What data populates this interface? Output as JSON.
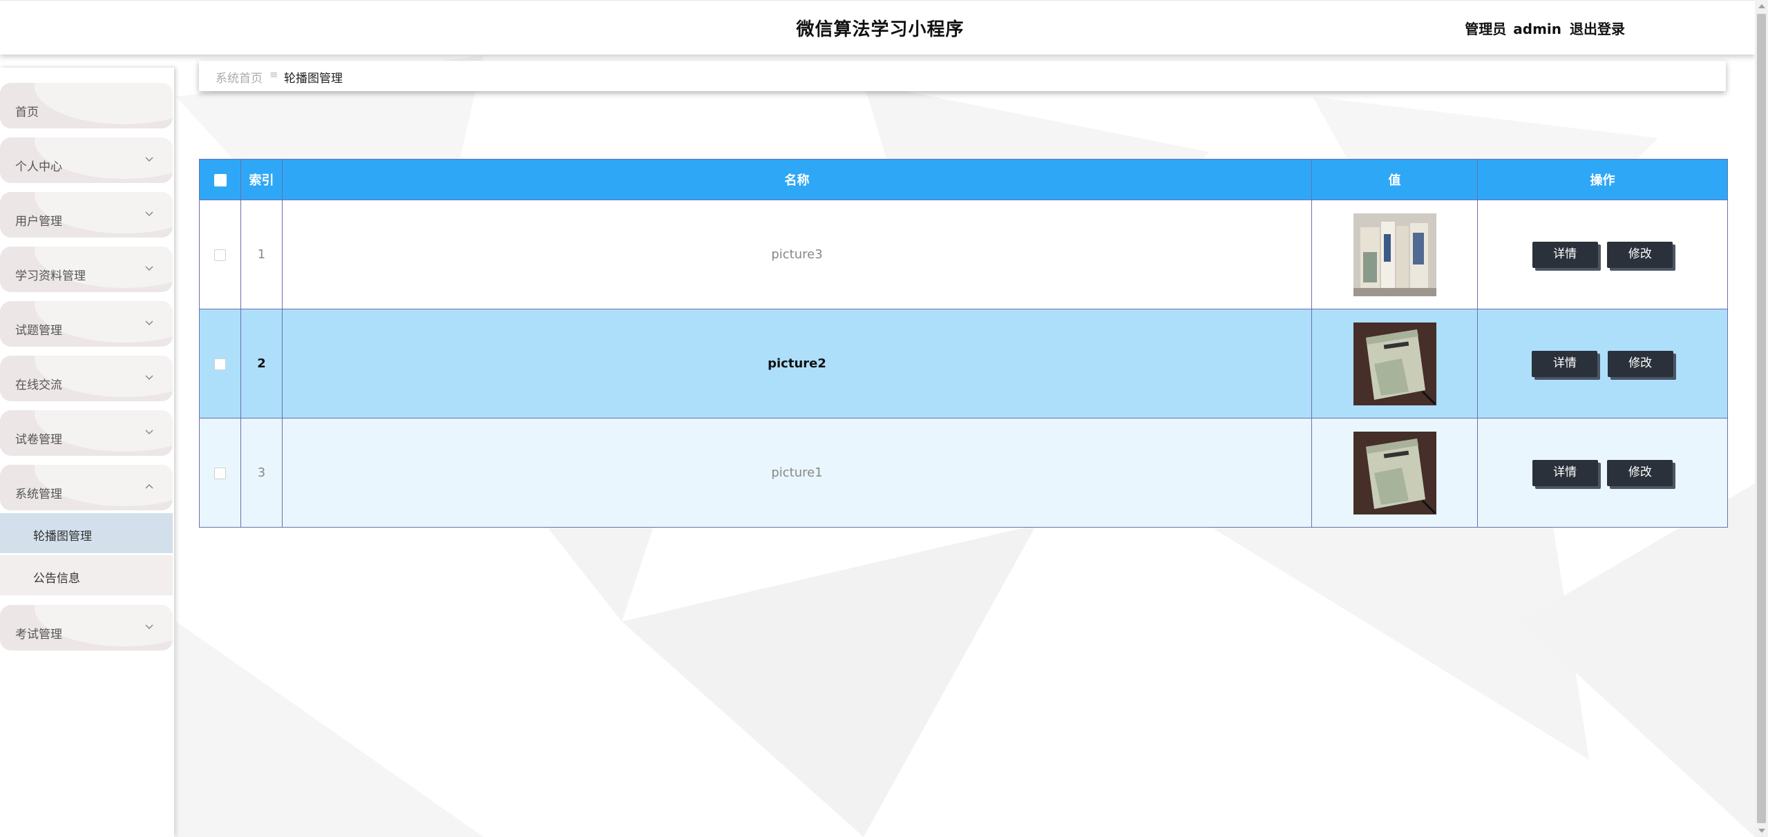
{
  "app": {
    "title": "微信算法学习小程序"
  },
  "user": {
    "role": "管理员",
    "name": "admin",
    "logout_label": "退出登录"
  },
  "sidebar": {
    "items": [
      {
        "label": "首页",
        "has_chevron": false
      },
      {
        "label": "个人中心",
        "has_chevron": true,
        "chevron": "down"
      },
      {
        "label": "用户管理",
        "has_chevron": true,
        "chevron": "down"
      },
      {
        "label": "学习资料管理",
        "has_chevron": true,
        "chevron": "down"
      },
      {
        "label": "试题管理",
        "has_chevron": true,
        "chevron": "down"
      },
      {
        "label": "在线交流",
        "has_chevron": true,
        "chevron": "down"
      },
      {
        "label": "试卷管理",
        "has_chevron": true,
        "chevron": "down"
      },
      {
        "label": "系统管理",
        "has_chevron": true,
        "chevron": "up",
        "expanded": true
      },
      {
        "label": "考试管理",
        "has_chevron": true,
        "chevron": "down"
      }
    ],
    "sub_items": [
      {
        "label": "轮播图管理",
        "active": true
      },
      {
        "label": "公告信息",
        "active": false
      }
    ]
  },
  "breadcrumb": {
    "home": "系统首页",
    "separator": "≡",
    "current": "轮播图管理"
  },
  "table": {
    "headers": {
      "index": "索引",
      "name": "名称",
      "value": "值",
      "actions": "操作"
    },
    "rows": [
      {
        "index": "1",
        "name": "picture3",
        "image": "books-on-shelf-thumbnail"
      },
      {
        "index": "2",
        "name": "picture2",
        "image": "book-on-desk-thumbnail"
      },
      {
        "index": "3",
        "name": "picture1",
        "image": "book-on-desk-thumbnail"
      }
    ],
    "detail_label": "详情",
    "edit_label": "修改"
  },
  "colors": {
    "header_bg": "#2ea8f6",
    "row_hover": "#addffb",
    "row_light": "#e9f6fd",
    "button_bg": "#2b313a",
    "submenu_active": "#d3e0ec"
  }
}
